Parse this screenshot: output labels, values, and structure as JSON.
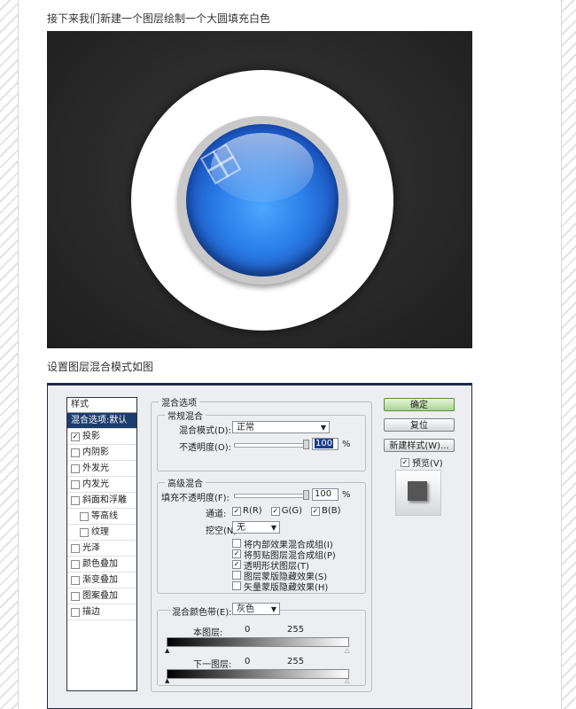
{
  "captions": {
    "top": "接下来我们新建一个图层绘制一个大圆填充白色",
    "middle": "设置图层混合模式如图"
  },
  "style_panel": {
    "header": "样式",
    "items": [
      {
        "label": "混合选项:默认",
        "checkbox": false,
        "checked": false,
        "selected": true,
        "indent": false
      },
      {
        "label": "投影",
        "checkbox": true,
        "checked": true,
        "selected": false,
        "indent": false
      },
      {
        "label": "内阴影",
        "checkbox": true,
        "checked": false,
        "selected": false,
        "indent": false
      },
      {
        "label": "外发光",
        "checkbox": true,
        "checked": false,
        "selected": false,
        "indent": false
      },
      {
        "label": "内发光",
        "checkbox": true,
        "checked": false,
        "selected": false,
        "indent": false
      },
      {
        "label": "斜面和浮雕",
        "checkbox": true,
        "checked": false,
        "selected": false,
        "indent": false
      },
      {
        "label": "等高线",
        "checkbox": true,
        "checked": false,
        "selected": false,
        "indent": true
      },
      {
        "label": "纹理",
        "checkbox": true,
        "checked": false,
        "selected": false,
        "indent": true
      },
      {
        "label": "光泽",
        "checkbox": true,
        "checked": false,
        "selected": false,
        "indent": false
      },
      {
        "label": "颜色叠加",
        "checkbox": true,
        "checked": false,
        "selected": false,
        "indent": false
      },
      {
        "label": "渐变叠加",
        "checkbox": true,
        "checked": false,
        "selected": false,
        "indent": false
      },
      {
        "label": "图案叠加",
        "checkbox": true,
        "checked": false,
        "selected": false,
        "indent": false
      },
      {
        "label": "描边",
        "checkbox": true,
        "checked": false,
        "selected": false,
        "indent": false
      }
    ]
  },
  "blend_options": {
    "title": "混合选项",
    "general": {
      "title": "常规混合",
      "mode_label": "混合模式(D):",
      "mode_value": "正常",
      "opacity_label": "不透明度(O):",
      "opacity_value": "100",
      "percent": "%"
    },
    "advanced": {
      "title": "高级混合",
      "fill_label": "填充不透明度(F):",
      "fill_value": "100",
      "percent": "%",
      "channels_label": "通道:",
      "channels": [
        "R(R)",
        "G(G)",
        "B(B)"
      ],
      "knockout_label": "挖空(N):",
      "knockout_value": "无",
      "checkboxes": [
        {
          "label": "将内部效果混合成组(I)",
          "checked": false
        },
        {
          "label": "将剪贴图层混合成组(P)",
          "checked": true
        },
        {
          "label": "透明形状图层(T)",
          "checked": true
        },
        {
          "label": "图层蒙版隐藏效果(S)",
          "checked": false
        },
        {
          "label": "矢量蒙版隐藏效果(H)",
          "checked": false
        }
      ]
    },
    "blend_if": {
      "label": "混合颜色带(E):",
      "value": "灰色",
      "this_layer": {
        "label": "本图层:",
        "low": "0",
        "high": "255"
      },
      "underlying": {
        "label": "下一图层:",
        "low": "0",
        "high": "255"
      }
    }
  },
  "buttons": {
    "ok": "确定",
    "reset": "复位",
    "new_style": "新建样式(W)...",
    "preview_label": "预览(V)",
    "preview_checked": true
  },
  "colors": {
    "selected_row": "#1c3d6e",
    "ok_button": "#a9d38e",
    "button_blue": "#2b7fe8"
  }
}
